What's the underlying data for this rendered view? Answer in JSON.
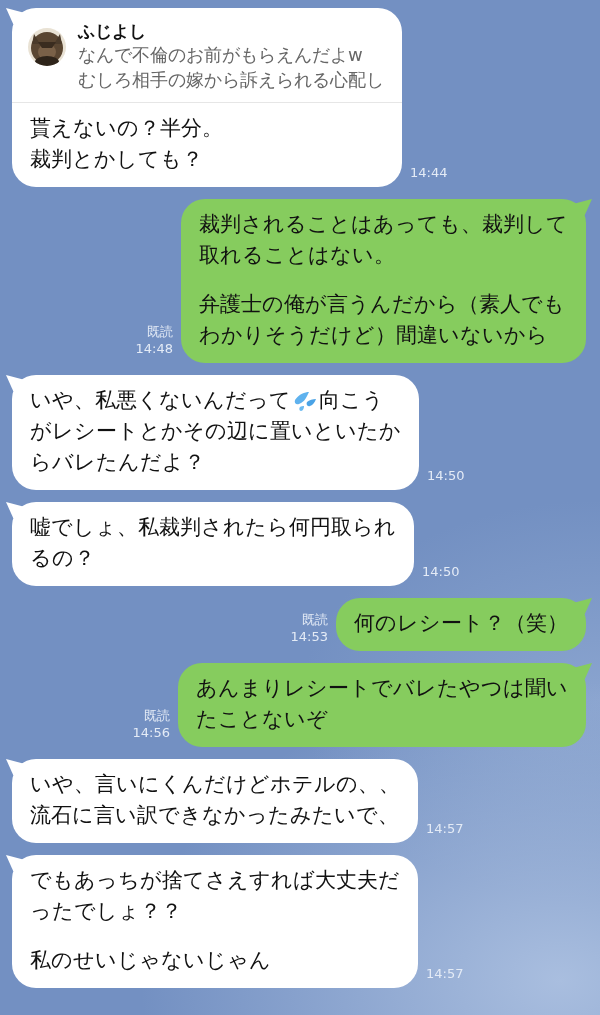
{
  "messages": [
    {
      "sent": false,
      "time": "14:44",
      "reply": {
        "name": "ふじよし",
        "lines": [
          "なんで不倫のお前がもらえんだよw",
          "むしろ相手の嫁から訴えられる心配し"
        ]
      },
      "content": [
        {
          "kind": "line",
          "text": "貰えないの？半分。"
        },
        {
          "kind": "line",
          "text": "裁判とかしても？"
        }
      ]
    },
    {
      "sent": true,
      "read": "既読",
      "time": "14:48",
      "content": [
        {
          "kind": "line",
          "text": "裁判されることはあっても、裁判して"
        },
        {
          "kind": "line",
          "text": "取れることはない。"
        },
        {
          "kind": "gap"
        },
        {
          "kind": "line",
          "text": "弁護士の俺が言うんだから（素人でも"
        },
        {
          "kind": "line",
          "text": "わかりそうだけど）間違いないから"
        }
      ]
    },
    {
      "sent": false,
      "time": "14:50",
      "content": [
        {
          "kind": "emoji_line",
          "before": "いや、私悪くないんだって",
          "after": "向こう"
        },
        {
          "kind": "line",
          "text": "がレシートとかその辺に置いといたか"
        },
        {
          "kind": "line",
          "text": "らバレたんだよ？"
        }
      ]
    },
    {
      "sent": false,
      "time": "14:50",
      "content": [
        {
          "kind": "line",
          "text": "嘘でしょ、私裁判されたら何円取られ"
        },
        {
          "kind": "line",
          "text": "るの？"
        }
      ]
    },
    {
      "sent": true,
      "read": "既読",
      "time": "14:53",
      "content": [
        {
          "kind": "line",
          "text": "何のレシート？（笑）"
        }
      ]
    },
    {
      "sent": true,
      "read": "既読",
      "time": "14:56",
      "content": [
        {
          "kind": "line",
          "text": "あんまりレシートでバレたやつは聞い"
        },
        {
          "kind": "line",
          "text": "たことないぞ"
        }
      ]
    },
    {
      "sent": false,
      "time": "14:57",
      "content": [
        {
          "kind": "line",
          "text": "いや、言いにくんだけどホテルの、、"
        },
        {
          "kind": "line",
          "text": "流石に言い訳できなかったみたいで、"
        }
      ]
    },
    {
      "sent": false,
      "time": "14:57",
      "content": [
        {
          "kind": "line",
          "text": "でもあっちが捨てさえすれば大丈夫だ"
        },
        {
          "kind": "line",
          "text": "ったでしょ？？"
        },
        {
          "kind": "gap"
        },
        {
          "kind": "line",
          "text": "私のせいじゃないじゃん"
        }
      ]
    }
  ]
}
